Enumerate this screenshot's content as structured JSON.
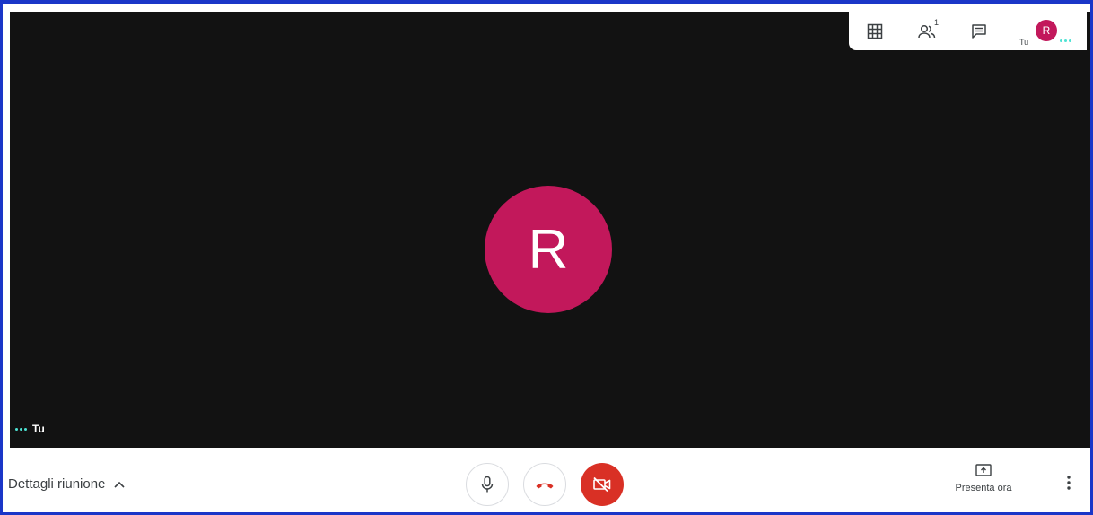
{
  "colors": {
    "stage_bg": "#121212",
    "avatar": "#c2185b",
    "danger": "#d93025",
    "speaking_dots": "#4ee3d4",
    "frame": "#1a36c8"
  },
  "participant": {
    "initial": "R",
    "self_label": "Tu"
  },
  "topbar": {
    "grid_icon": "grid-layout-icon",
    "people_icon": "people-icon",
    "people_count": "1",
    "chat_icon": "chat-icon",
    "self_tile_label": "Tu",
    "self_tile_initial": "R"
  },
  "bottom_bar": {
    "details_label": "Dettagli riunione",
    "details_icon": "chevron-up-icon",
    "mic_icon": "microphone-icon",
    "hangup_icon": "phone-hangup-icon",
    "camera_icon": "camera-off-icon",
    "present_label": "Presenta ora",
    "present_icon": "present-screen-icon",
    "more_icon": "more-vertical-icon"
  }
}
